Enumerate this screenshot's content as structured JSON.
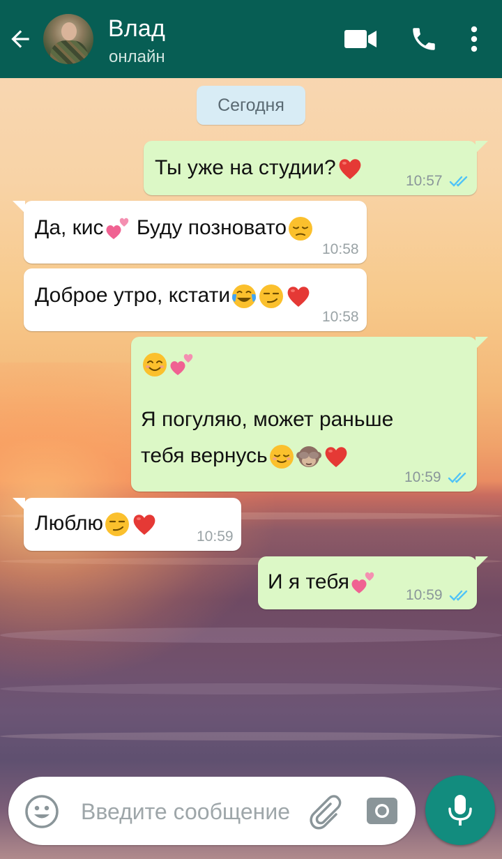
{
  "header": {
    "contact_name": "Влад",
    "status": "онлайн"
  },
  "chat": {
    "date_label": "Сегодня",
    "messages": [
      {
        "direction": "out",
        "text": "Ты уже на студии?",
        "emoji": [
          "red-heart"
        ],
        "time": "10:57",
        "read": true
      },
      {
        "direction": "in",
        "text_parts": [
          "Да, кис",
          " Буду позновато"
        ],
        "emoji": [
          "two-hearts",
          "pensive-face"
        ],
        "time": "10:58"
      },
      {
        "direction": "in",
        "text": "Доброе утро, кстати",
        "emoji": [
          "face-with-tears-of-joy",
          "smirking-face",
          "red-heart"
        ],
        "time": "10:58"
      },
      {
        "direction": "out",
        "line1_emoji": [
          "smiling-face",
          "two-hearts"
        ],
        "lines": [
          "Я погуляю, может раньше",
          "тебя вернусь"
        ],
        "emoji": [
          "relieved-face",
          "see-no-evil-monkey",
          "red-heart"
        ],
        "time": "10:59",
        "read": true
      },
      {
        "direction": "in",
        "text": "Люблю",
        "emoji": [
          "smirking-face",
          "red-heart"
        ],
        "time": "10:59"
      },
      {
        "direction": "out",
        "text": "И я тебя",
        "emoji": [
          "two-hearts"
        ],
        "time": "10:59",
        "read": true
      }
    ]
  },
  "composer": {
    "placeholder": "Введите сообщение"
  },
  "icons": {
    "back": "arrow-left-icon",
    "video": "video-camera-icon",
    "call": "phone-icon",
    "menu": "more-vertical-icon",
    "emoji": "smiley-icon",
    "attach": "paperclip-icon",
    "camera": "camera-icon",
    "mic": "microphone-icon"
  },
  "colors": {
    "header_bg": "#075e54",
    "outgoing_bubble": "#dcf8c6",
    "incoming_bubble": "#ffffff",
    "read_ticks": "#4fc3f7",
    "mic_button": "#128c7e",
    "date_chip": "#d8ecf5"
  }
}
